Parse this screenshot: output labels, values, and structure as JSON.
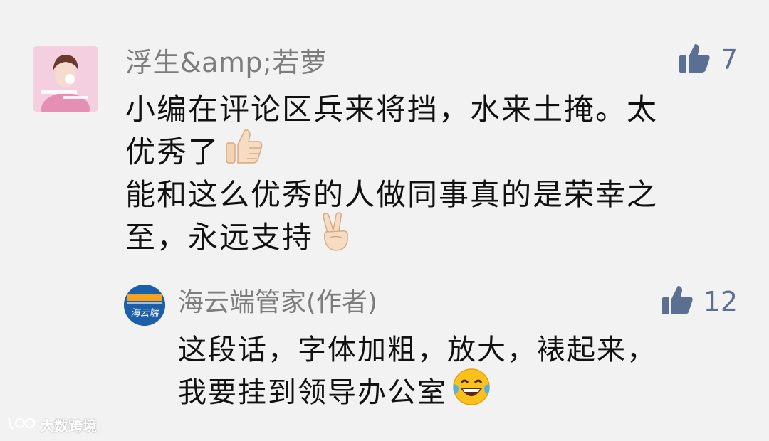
{
  "comment": {
    "avatar_icon": "profile-photo",
    "nickname": "浮生&amp;若萝",
    "like_icon": "thumbs-up-icon",
    "like_count": "7",
    "lines": [
      "小编在评论区兵来将挡，水来土掩。太",
      "优秀了",
      "能和这么优秀的人做同事真的是荣幸之",
      "至，永远支持"
    ],
    "emojis": [
      "thumbs-up-emoji",
      "victory-hand-emoji"
    ]
  },
  "reply": {
    "avatar_icon": "haiyunduan-logo",
    "nickname": "海云端管家(作者)",
    "like_icon": "thumbs-up-icon",
    "like_count": "12",
    "lines": [
      "这段话，字体加粗，放大，裱起来，",
      "我要挂到领导办公室"
    ],
    "emojis": [
      "tears-of-joy-emoji"
    ]
  },
  "watermark": {
    "text": "大数跨境",
    "icon": "brand-logo-icon"
  },
  "colors": {
    "background": "#f2f2f2",
    "nickname": "#7c7c7c",
    "like_blue": "#5a6f92",
    "text": "#111111"
  }
}
